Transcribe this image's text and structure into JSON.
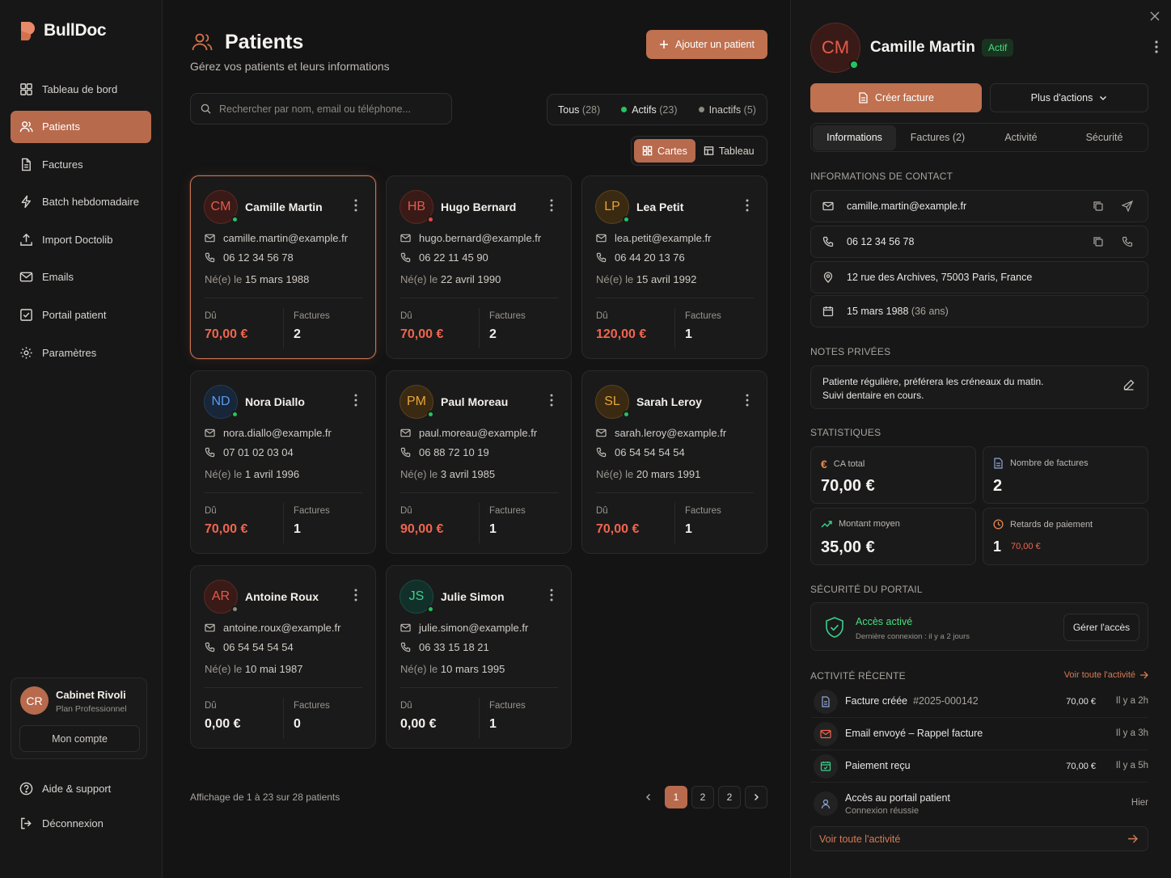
{
  "brand": {
    "name": "BullDoc",
    "accent": "#c0714f"
  },
  "nav": [
    {
      "label": "Tableau de bord",
      "icon": "dashboard-icon"
    },
    {
      "label": "Patients",
      "icon": "users-icon",
      "active": true
    },
    {
      "label": "Factures",
      "icon": "file-icon"
    },
    {
      "label": "Batch hebdomadaire",
      "icon": "bolt-icon"
    },
    {
      "label": "Import Doctolib",
      "icon": "upload-icon"
    },
    {
      "label": "Emails",
      "icon": "mail-icon"
    },
    {
      "label": "Portail patient",
      "icon": "checkbox-icon"
    },
    {
      "label": "Paramètres",
      "icon": "gear-icon"
    }
  ],
  "account": {
    "initials": "CR",
    "name": "Cabinet Rivoli",
    "plan": "Plan Professionnel",
    "button": "Mon compte"
  },
  "footer": {
    "help": "Aide & support",
    "logout": "Déconnexion"
  },
  "header": {
    "title": "Patients",
    "subtitle": "Gérez vos patients et leurs informations",
    "add_button": "Ajouter un patient"
  },
  "search": {
    "placeholder": "Rechercher par nom, email ou téléphone...",
    "value": ""
  },
  "filters": {
    "all": {
      "label": "Tous",
      "count": "(28)"
    },
    "active": {
      "label": "Actifs",
      "count": "(23)"
    },
    "inactive": {
      "label": "Inactifs",
      "count": "(5)"
    }
  },
  "views": {
    "cards": "Cartes",
    "table": "Tableau"
  },
  "labels": {
    "born": "Né(e) le",
    "due": "Dû",
    "invoices": "Factures"
  },
  "patients": [
    {
      "initials": "CM",
      "name": "Camille Martin",
      "email": "camille.martin@example.fr",
      "phone": "06 12 34 56 78",
      "born": "15 mars 1988",
      "due": "70,00 €",
      "invoices": "2",
      "status": "active",
      "color": "#e25c4c",
      "bg": "#3a1a17",
      "border": "#5a2a24",
      "due_color": "#f0654f"
    },
    {
      "initials": "HB",
      "name": "Hugo Bernard",
      "email": "hugo.bernard@example.fr",
      "phone": "06 22 11 45 90",
      "born": "22 avril 1990",
      "due": "70,00 €",
      "invoices": "2",
      "status": "alert",
      "color": "#e25c4c",
      "bg": "#3a1a17",
      "border": "#5a2a24",
      "due_color": "#f0654f"
    },
    {
      "initials": "LP",
      "name": "Lea Petit",
      "email": "lea.petit@example.fr",
      "phone": "06 44 20 13 76",
      "born": "15 avril 1992",
      "due": "120,00 €",
      "invoices": "1",
      "status": "active",
      "color": "#e8a43a",
      "bg": "#3a2a12",
      "border": "#5a4220",
      "due_color": "#f0654f"
    },
    {
      "initials": "ND",
      "name": "Nora Diallo",
      "email": "nora.diallo@example.fr",
      "phone": "07 01 02 03 04",
      "born": "1 avril 1996",
      "due": "70,00 €",
      "invoices": "1",
      "status": "active",
      "color": "#5b9af0",
      "bg": "#172638",
      "border": "#243b58",
      "due_color": "#f0654f"
    },
    {
      "initials": "PM",
      "name": "Paul Moreau",
      "email": "paul.moreau@example.fr",
      "phone": "06 88 72 10 19",
      "born": "3 avril 1985",
      "due": "90,00 €",
      "invoices": "1",
      "status": "active",
      "color": "#e8a43a",
      "bg": "#3a2a12",
      "border": "#5a4220",
      "due_color": "#f0654f"
    },
    {
      "initials": "SL",
      "name": "Sarah Leroy",
      "email": "sarah.leroy@example.fr",
      "phone": "06 54 54 54 54",
      "born": "20 mars 1991",
      "due": "70,00 €",
      "invoices": "1",
      "status": "active",
      "color": "#e8a43a",
      "bg": "#3a2a12",
      "border": "#5a4220",
      "due_color": "#f0654f"
    },
    {
      "initials": "AR",
      "name": "Antoine Roux",
      "email": "antoine.roux@example.fr",
      "phone": "06 54 54 54 54",
      "born": "10 mai 1987",
      "due": "0,00 €",
      "invoices": "0",
      "status": "inactive",
      "color": "#e25c4c",
      "bg": "#3a1a17",
      "border": "#5a2a24",
      "due_color": "#f2efeb"
    },
    {
      "initials": "JS",
      "name": "Julie Simon",
      "email": "julie.simon@example.fr",
      "phone": "06 33 15 18 21",
      "born": "10 mars 1995",
      "due": "0,00 €",
      "invoices": "1",
      "status": "active",
      "color": "#3ecf8e",
      "bg": "#12302a",
      "border": "#1e4a3e",
      "due_color": "#f2efeb"
    }
  ],
  "pagination": {
    "info": "Affichage de 1 à 23 sur 28 patients",
    "pages": [
      "1",
      "2",
      "2"
    ],
    "current": "1"
  },
  "detail": {
    "initials": "CM",
    "name": "Camille Martin",
    "badge": "Actif",
    "create_invoice": "Créer facture",
    "more_actions": "Plus d'actions",
    "tabs": [
      "Informations",
      "Factures (2)",
      "Activité",
      "Sécurité"
    ],
    "contact_title": "INFORMATIONS DE CONTACT",
    "email": "camille.martin@example.fr",
    "phone": "06 12 34 56 78",
    "address": "12 rue des Archives, 75003 Paris, France",
    "birth": "15 mars 1988",
    "age": "(36 ans)",
    "notes_title": "NOTES PRIVÉES",
    "notes_line1": "Patiente régulière, préférera les créneaux du matin.",
    "notes_line2": "Suivi dentaire en cours.",
    "stats_title": "STATISTIQUES",
    "stats": {
      "ca_label": "CA total",
      "ca_value": "70,00 €",
      "nb_label": "Nombre de factures",
      "nb_value": "2",
      "avg_label": "Montant moyen",
      "avg_value": "35,00 €",
      "late_label": "Retards de paiement",
      "late_value": "1",
      "late_amount": "70,00 €"
    },
    "security_title": "SÉCURITÉ DU PORTAIL",
    "security_status": "Accès activé",
    "security_sub": "Dernière connexion : il y a 2 jours",
    "security_button": "Gérer l'accès",
    "activity_title": "ACTIVITÉ RÉCENTE",
    "see_all": "Voir toute l'activité",
    "activity": [
      {
        "title": "Facture créée",
        "ref": "#2025-000142",
        "amount": "70,00 €",
        "time": "Il y a 2h",
        "icon": "invoice-icon"
      },
      {
        "title": "Email envoyé – Rappel facture",
        "amount": "",
        "time": "Il y a 3h",
        "icon": "mail-icon"
      },
      {
        "title": "Paiement reçu",
        "amount": "70,00 €",
        "time": "Il y a 5h",
        "icon": "payment-icon"
      },
      {
        "title": "Accès au portail patient",
        "sub": "Connexion réussie",
        "time": "Hier",
        "icon": "portal-icon"
      }
    ]
  }
}
